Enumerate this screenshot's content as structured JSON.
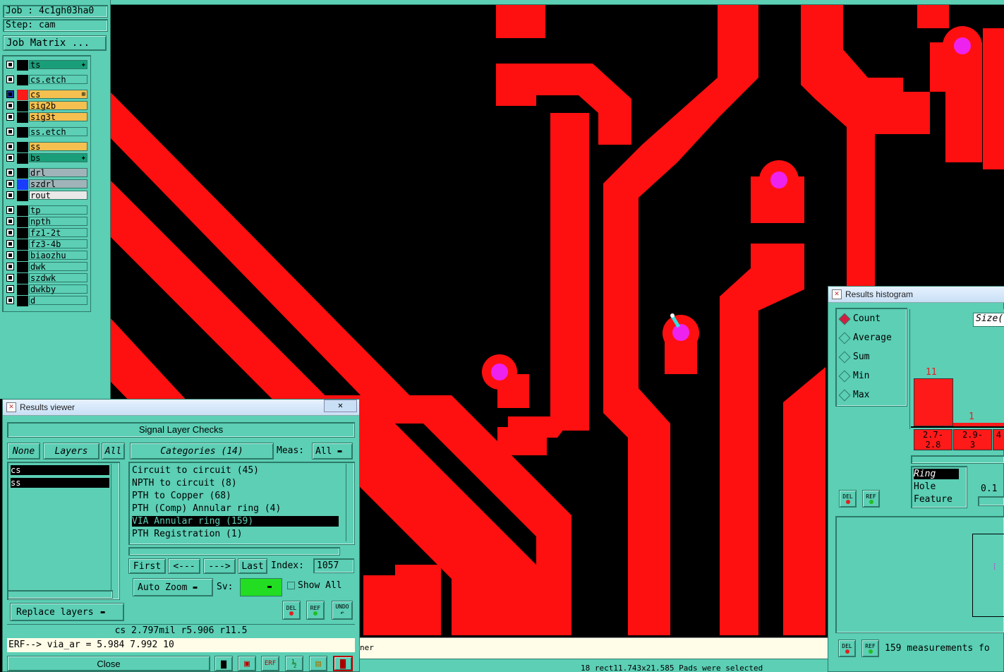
{
  "job_panel": {
    "job_label": "Job : 4c1gh03ha0",
    "step_label": "Step: cam",
    "job_matrix_button": "Job Matrix ..."
  },
  "layers": [
    {
      "name": "ts",
      "swatch": "#000000",
      "bg": "#1a9e7a",
      "marker": "✚"
    },
    {
      "name": "cs.etch",
      "swatch": "#000000",
      "bg": "#5ccfb5",
      "marker": ""
    },
    {
      "name": "cs",
      "swatch": "#ff1a1a",
      "bg": "#f5c050",
      "marker": "⊞"
    },
    {
      "name": "sig2b",
      "swatch": "#000000",
      "bg": "#f5c050",
      "marker": ""
    },
    {
      "name": "sig3t",
      "swatch": "#000000",
      "bg": "#f5c050",
      "marker": ""
    },
    {
      "name": "ss.etch",
      "swatch": "#000000",
      "bg": "#5ccfb5",
      "marker": ""
    },
    {
      "name": "ss",
      "swatch": "#000000",
      "bg": "#f5c050",
      "marker": ""
    },
    {
      "name": "bs",
      "swatch": "#000000",
      "bg": "#1a9e7a",
      "marker": "✚"
    },
    {
      "name": "drl",
      "swatch": "#000000",
      "bg": "#9fb3b8",
      "marker": ""
    },
    {
      "name": "szdrl",
      "swatch": "#1a3cff",
      "bg": "#9fb3b8",
      "marker": ""
    },
    {
      "name": "rout",
      "swatch": "#000000",
      "bg": "#e8e8e8",
      "marker": ""
    },
    {
      "name": "tp",
      "swatch": "#000000",
      "bg": "#5ccfb5",
      "marker": ""
    },
    {
      "name": "npth",
      "swatch": "#000000",
      "bg": "#5ccfb5",
      "marker": ""
    },
    {
      "name": "fz1-2t",
      "swatch": "#000000",
      "bg": "#5ccfb5",
      "marker": ""
    },
    {
      "name": "fz3-4b",
      "swatch": "#000000",
      "bg": "#5ccfb5",
      "marker": ""
    },
    {
      "name": "biaozhu",
      "swatch": "#000000",
      "bg": "#5ccfb5",
      "marker": ""
    },
    {
      "name": "dwk",
      "swatch": "#000000",
      "bg": "#5ccfb5",
      "marker": ""
    },
    {
      "name": "szdwk",
      "swatch": "#000000",
      "bg": "#5ccfb5",
      "marker": ""
    },
    {
      "name": "dwkby",
      "swatch": "#000000",
      "bg": "#5ccfb5",
      "marker": ""
    },
    {
      "name": "d",
      "swatch": "#000000",
      "bg": "#5ccfb5",
      "marker": ""
    }
  ],
  "results_viewer": {
    "title": "Results viewer",
    "close_x": "✕",
    "header": "Signal Layer Checks",
    "none_btn": "None",
    "layers_btn": "Layers",
    "all_btn": "All",
    "layer_list": [
      "cs",
      "ss"
    ],
    "categories_btn": "Categories (14)",
    "meas_label": "Meas:",
    "meas_value": "All",
    "categories": [
      "Circuit to circuit (45)",
      "NPTH to circuit (8)",
      "PTH to Copper (68)",
      "PTH (Comp) Annular ring (4)",
      "VIA Annular ring (159)",
      "PTH Registration (1)"
    ],
    "first_btn": "First",
    "prev_btn": "<---",
    "next_btn": "--->",
    "last_btn": "Last",
    "index_label": "Index:",
    "index_value": "1057",
    "auto_zoom": "Auto Zoom",
    "sv_label": "Sv:",
    "show_all": "Show All",
    "replace_layers": "Replace layers",
    "del_label": "DEL",
    "ref_label": "REF",
    "undo_label": "UNDO",
    "status_line": "cs 2.797mil  r5.906  r11.5",
    "erf_line": "ERF--> via_ar = 5.984 7.992 10",
    "close_btn": "Close"
  },
  "histogram": {
    "title": "Results histogram",
    "modes": [
      "Count",
      "Average",
      "Sum",
      "Min",
      "Max"
    ],
    "size_label": "Size(",
    "bar_values": [
      "11",
      "1"
    ],
    "bin_labels": [
      [
        "2.7-",
        "2.8"
      ],
      [
        "2.9-",
        "3"
      ],
      [
        "4",
        ""
      ]
    ],
    "selection": [
      "Ring",
      "Hole",
      "Feature"
    ],
    "step_value": "0.1",
    "footer_text": "159 measurements fo",
    "del_label": "DEL",
    "ref_label": "REF"
  },
  "bottom_bar": {
    "fragment": "ner",
    "selected_text": "18 rect11.743x21.585 Pads were selected"
  },
  "colors": {
    "panel": "#5ccfb5",
    "copper": "#ff1010",
    "drill": "#ee22ee",
    "highlight": "#000000"
  }
}
